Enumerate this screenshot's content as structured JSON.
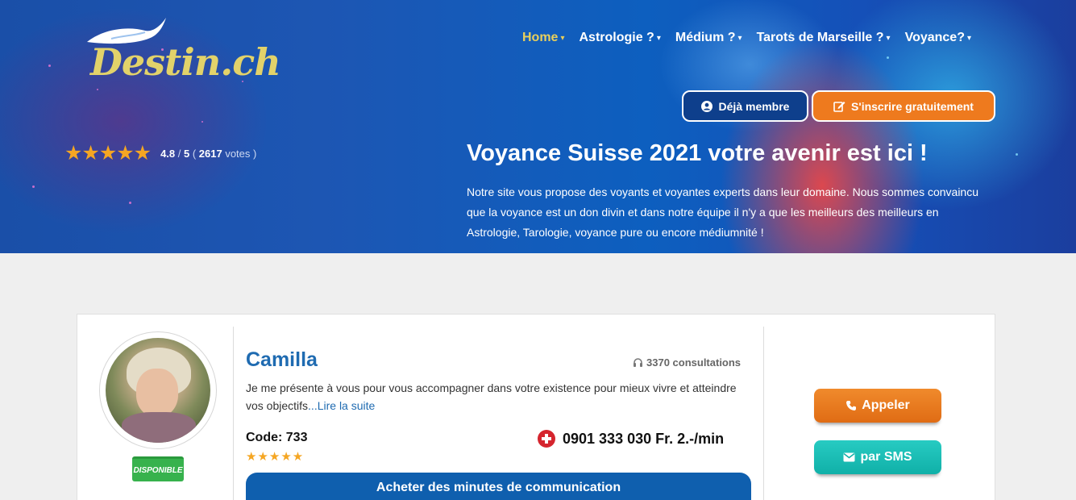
{
  "brand": {
    "logo_text": "Destin.ch"
  },
  "rating": {
    "stars": "★★★★★",
    "score": "4.8",
    "slash": " / ",
    "max": "5",
    "open": " ( ",
    "votes": "2617",
    "votes_label": " votes )"
  },
  "nav": {
    "items": [
      {
        "label": "Home",
        "active": true
      },
      {
        "label": "Astrologie ?"
      },
      {
        "label": "Médium ?"
      },
      {
        "label": "Tarots de Marseille ?"
      },
      {
        "label": "Voyance?"
      }
    ],
    "chevron": "⌄"
  },
  "auth": {
    "member_label": "Déjà membre",
    "signup_label": "S'inscrire gratuitement"
  },
  "hero": {
    "title": "Voyance Suisse 2021 votre avenir est ici !",
    "description": "Notre site vous propose des voyants et voyantes experts dans leur domaine. Nous sommes convaincu que la voyance est un don divin et dans notre équipe il n'y a que les meilleurs des meilleurs en Astrologie, Tarologie, voyance pure ou encore médiumnité !"
  },
  "card": {
    "status": "DISPONIBLE",
    "name": "Camilla",
    "consultations": "3370 consultations",
    "bio": "Je me présente à vous pour vous accompagner dans votre existence pour mieux vivre et atteindre vos objectifs",
    "read_more": "...Lire la suite",
    "code": "Code: 733",
    "stars": "★★★★★",
    "phone": "0901 333 030 Fr. 2.-/min",
    "buy_label": "Acheter des minutes de communication",
    "call_label": "Appeler",
    "sms_label": "par SMS"
  },
  "colors": {
    "accent_orange": "#ee7a1e",
    "accent_teal": "#1bbdb4",
    "brand_blue": "#1f6bb1",
    "nav_active": "#e8cf5c"
  }
}
